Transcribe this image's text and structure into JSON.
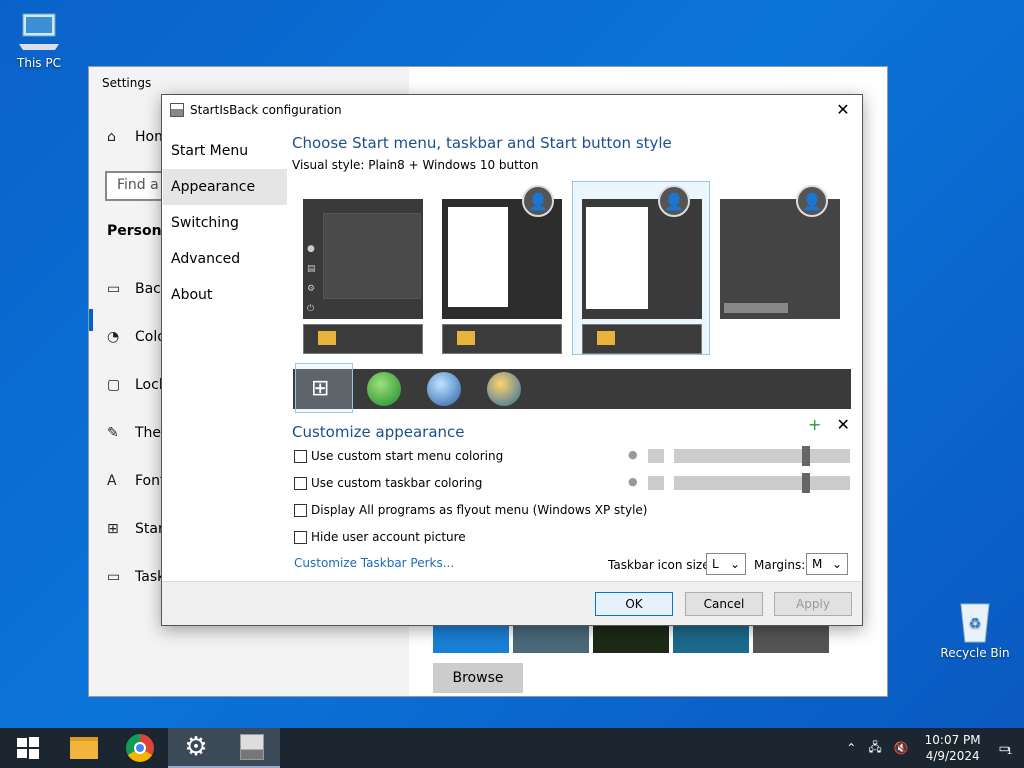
{
  "desktop": {
    "this_pc": "This PC",
    "recycle_bin": "Recycle Bin"
  },
  "settings": {
    "title": "Settings",
    "search_placeholder": "Find a s",
    "home": "Hom",
    "section": "Personali",
    "items": [
      "Back",
      "Colo",
      "Lock",
      "Ther",
      "Font",
      "Start",
      "Task"
    ],
    "browse": "Browse"
  },
  "dialog": {
    "title": "StartIsBack configuration",
    "nav": [
      "Start Menu",
      "Appearance",
      "Switching",
      "Advanced",
      "About"
    ],
    "selected_nav": "Appearance",
    "heading": "Choose Start menu, taskbar and Start button style",
    "visual_style": "Visual style:  Plain8 + Windows 10 button",
    "customize_heading": "Customize appearance",
    "options": [
      "Use custom start menu coloring",
      "Use custom taskbar coloring",
      "Display All programs as flyout menu (Windows XP style)",
      "Hide user account picture"
    ],
    "perks_link": "Customize Taskbar Perks...",
    "icon_size_label": "Taskbar icon size:",
    "icon_size_value": "L",
    "margins_label": "Margins:",
    "margins_value": "M",
    "ok": "OK",
    "cancel": "Cancel",
    "apply": "Apply"
  },
  "taskbar": {
    "time": "10:07 PM",
    "date": "4/9/2024",
    "notification_count": "1"
  },
  "colors": {
    "accent": "#0067c0",
    "heading": "#1b4f91",
    "link": "#1b6db8",
    "desktop": "#0b74da"
  }
}
